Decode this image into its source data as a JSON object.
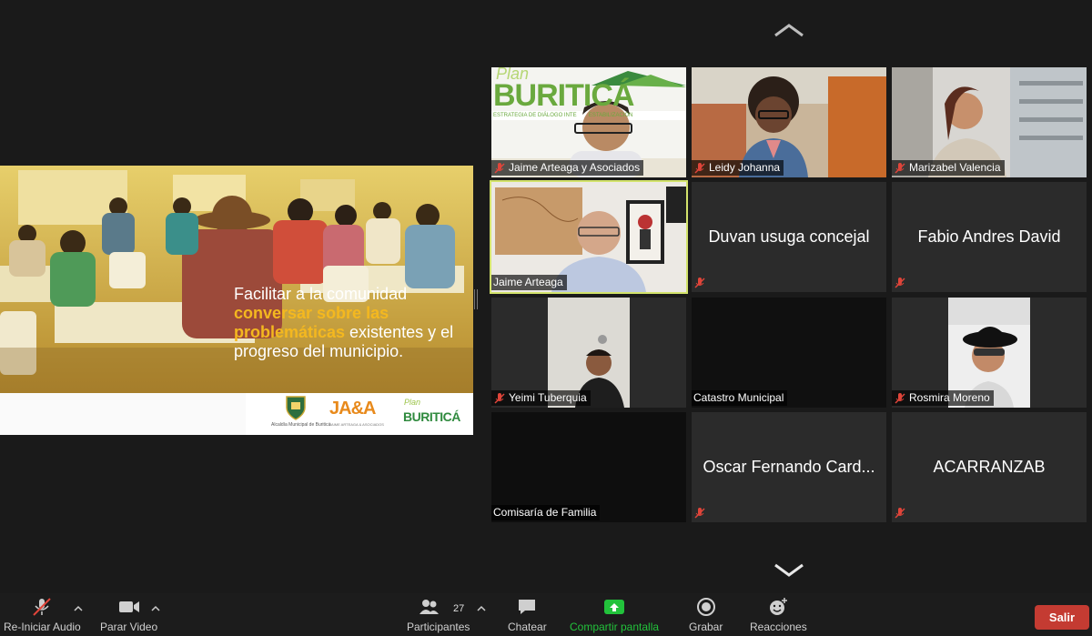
{
  "slide": {
    "text_line1": "Facilitar a la comunidad",
    "text_highlight": "conversar sobre las problemáticas",
    "text_rest": " existentes y el progreso del municipio.",
    "footer_caption": "Alcaldía Municipal de Buriticá",
    "logo_jaa": "JA&A",
    "logo_jaa_sub": "JAIME ARTEAGA & ASOCIADOS",
    "logo_plan": "Plan",
    "logo_buritica": "BURITICÁ",
    "highlight_color": "#f4b81f"
  },
  "participants": [
    {
      "name": "Jaime Arteaga y Asociados",
      "muted": true
    },
    {
      "name": "Leidy Johanna",
      "muted": true
    },
    {
      "name": "Marizabel Valencia",
      "muted": true
    },
    {
      "name": "Jaime Arteaga",
      "muted": false,
      "active_speaker": true
    },
    {
      "name": "Duvan usuga concejal",
      "muted": true
    },
    {
      "name": "Fabio Andres David",
      "muted": true
    },
    {
      "name": "Yeimi Tuberquia",
      "muted": true
    },
    {
      "name": "Catastro Municipal",
      "muted": false
    },
    {
      "name": "Rosmira Moreno",
      "muted": true
    },
    {
      "name": "Comisaría de Familia",
      "muted": false
    },
    {
      "name": "Oscar Fernando Card...",
      "muted": true
    },
    {
      "name": "ACARRANZAB",
      "muted": true
    }
  ],
  "tile1_banner": {
    "plan": "Plan",
    "title": "BURITICÁ",
    "sub": "ESTRATEGIA DE DIÁLOGO INTE        ESTABILIZACIÓN"
  },
  "toolbar": {
    "audio": "Re-Iniciar Audio",
    "video": "Parar Video",
    "participants": "Participantes",
    "participants_count": "27",
    "chat": "Chatear",
    "share": "Compartir pantalla",
    "record": "Grabar",
    "reactions": "Reacciones",
    "leave": "Salir"
  },
  "colors": {
    "active_outline": "#d3e36b",
    "share_green": "#22c23b",
    "leave_red": "#c43b32",
    "muted_red": "#e0453a"
  }
}
